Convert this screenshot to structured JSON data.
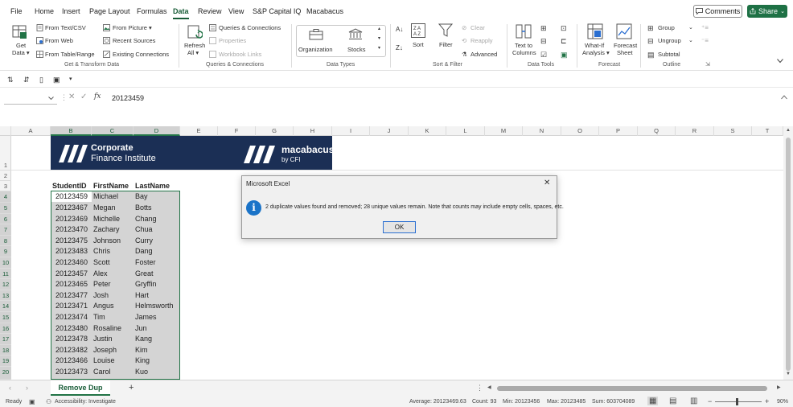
{
  "menu": {
    "tabs": [
      "File",
      "Home",
      "Insert",
      "Page Layout",
      "Formulas",
      "Data",
      "Review",
      "View",
      "S&P Capital IQ",
      "Macabacus"
    ],
    "active_tab": "Data",
    "comments_label": "Comments",
    "share_label": "Share"
  },
  "ribbon": {
    "get_data": {
      "line1": "Get",
      "line2": "Data ▾"
    },
    "from_text_csv": "From Text/CSV",
    "from_web": "From Web",
    "from_table_range": "From Table/Range",
    "from_picture": "From Picture ▾",
    "recent_sources": "Recent Sources",
    "existing_connections": "Existing Connections",
    "group_get_transform": "Get & Transform Data",
    "refresh_all": {
      "line1": "Refresh",
      "line2": "All ▾"
    },
    "queries_connections": "Queries & Connections",
    "properties": "Properties",
    "workbook_links": "Workbook Links",
    "group_queries": "Queries & Connections",
    "organization": "Organization",
    "stocks": "Stocks",
    "group_data_types": "Data Types",
    "sort": "Sort",
    "filter": "Filter",
    "clear": "Clear",
    "reapply": "Reapply",
    "advanced": "Advanced",
    "group_sort_filter": "Sort & Filter",
    "text_to_columns": {
      "line1": "Text to",
      "line2": "Columns"
    },
    "group_data_tools": "Data Tools",
    "what_if": {
      "line1": "What-If",
      "line2": "Analysis ▾"
    },
    "forecast_sheet": {
      "line1": "Forecast",
      "line2": "Sheet"
    },
    "group_forecast": "Forecast",
    "group_btn": "Group",
    "ungroup_btn": "Ungroup",
    "subtotal": "Subtotal",
    "group_outline": "Outline"
  },
  "formula_bar": {
    "fx": "fx",
    "value": "20123459"
  },
  "grid": {
    "columns": [
      "A",
      "B",
      "C",
      "D",
      "E",
      "F",
      "G",
      "H",
      "I",
      "J",
      "K",
      "L",
      "M",
      "N",
      "O",
      "P",
      "Q",
      "R",
      "S",
      "T"
    ],
    "rows": [
      "1",
      "2",
      "3",
      "4",
      "5",
      "6",
      "7",
      "8",
      "9",
      "10",
      "11",
      "12",
      "13",
      "14",
      "15",
      "16",
      "17",
      "18",
      "19",
      "20"
    ],
    "headers": [
      "StudentID",
      "FirstName",
      "LastName"
    ],
    "records": [
      [
        "20123459",
        "Michael",
        "Bay"
      ],
      [
        "20123467",
        "Megan",
        "Botts"
      ],
      [
        "20123469",
        "Michelle",
        "Chang"
      ],
      [
        "20123470",
        "Zachary",
        "Chua"
      ],
      [
        "20123475",
        "Johnson",
        "Curry"
      ],
      [
        "20123483",
        "Chris",
        "Dang"
      ],
      [
        "20123460",
        "Scott",
        "Foster"
      ],
      [
        "20123457",
        "Alex",
        "Great"
      ],
      [
        "20123465",
        "Peter",
        "Gryffin"
      ],
      [
        "20123477",
        "Josh",
        "Hart"
      ],
      [
        "20123471",
        "Angus",
        "Helmsworth"
      ],
      [
        "20123474",
        "Tim",
        "James"
      ],
      [
        "20123480",
        "Rosaline",
        "Jun"
      ],
      [
        "20123478",
        "Justin",
        "Kang"
      ],
      [
        "20123482",
        "Joseph",
        "Kim"
      ],
      [
        "20123466",
        "Louise",
        "King"
      ],
      [
        "20123473",
        "Carol",
        "Kuo"
      ]
    ]
  },
  "banner": {
    "cfi_line1": "Corporate",
    "cfi_line2": "Finance Institute",
    "macabacus_line1": "macabacus",
    "macabacus_line2": "by CFI"
  },
  "dialog": {
    "title": "Microsoft Excel",
    "message": "2 duplicate values found and removed; 28 unique values remain. Note that counts may include empty cells, spaces, etc.",
    "ok_label": "OK",
    "icon_glyph": "i"
  },
  "sheet": {
    "tab_label": "Remove Dup",
    "add_label": "+"
  },
  "status": {
    "ready": "Ready",
    "accessibility": "Accessibility: Investigate",
    "average": "Average: 20123469.63",
    "count": "Count: 93",
    "min": "Min: 20123456",
    "max": "Max: 20123485",
    "sum": "Sum: 603704089",
    "zoom": "90%"
  },
  "colors": {
    "excel_green": "#217346",
    "banner_navy": "#1b2f55",
    "info_blue": "#1a73c8"
  }
}
